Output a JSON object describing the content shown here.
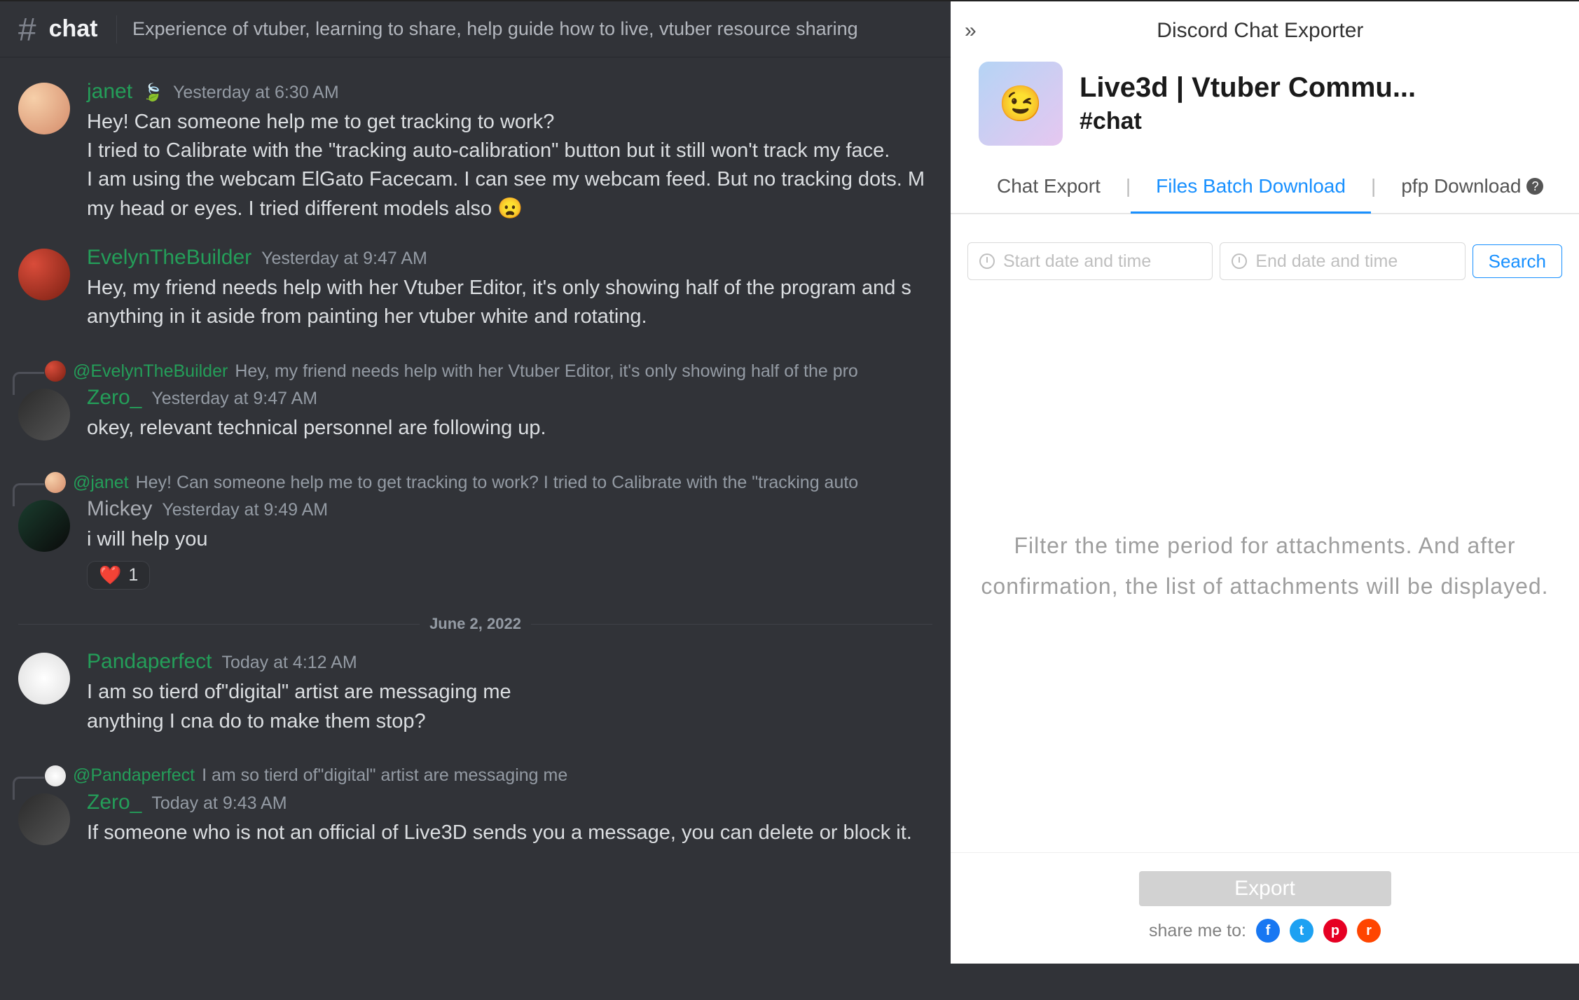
{
  "channel": {
    "name": "chat",
    "topic": "Experience of vtuber, learning to share, help guide how to live, vtuber resource sharing"
  },
  "date_divider": "June 2, 2022",
  "messages": [
    {
      "author": "janet",
      "author_style": "green",
      "leaf": true,
      "timestamp": "Yesterday at 6:30 AM",
      "avatar_class": "av-janet",
      "text": "Hey! Can someone help me to get tracking to work?\nI tried to Calibrate with the \"tracking auto-calibration\" button but it still won't track my face.\nI am using the webcam ElGato Facecam. I can see my webcam feed. But no tracking dots. M\nmy head or eyes. I tried different models also 😦"
    },
    {
      "author": "EvelynTheBuilder",
      "author_style": "green",
      "timestamp": "Yesterday at 9:47 AM",
      "avatar_class": "av-evelyn",
      "text": "Hey, my friend needs help with her Vtuber Editor, it's only showing half of the program and s\nanything in it aside from painting her vtuber white and rotating."
    },
    {
      "reply": {
        "author": "@EvelynTheBuilder",
        "author_style": "green",
        "avatar_class": "av-evelyn",
        "text": "Hey, my friend needs help with her Vtuber Editor, it's only showing half of the pro"
      },
      "author": "Zero_",
      "author_style": "green",
      "timestamp": "Yesterday at 9:47 AM",
      "avatar_class": "av-zero",
      "text": "okey, relevant technical personnel are following up."
    },
    {
      "reply": {
        "author": "@janet",
        "author_style": "green",
        "avatar_class": "av-janet",
        "text": "Hey! Can someone help me to get tracking to work?  I tried to Calibrate with the \"tracking auto"
      },
      "author": "Mickey",
      "author_style": "gray",
      "timestamp": "Yesterday at 9:49 AM",
      "avatar_class": "av-mickey",
      "text": "i will help you",
      "reaction": {
        "emoji": "❤️",
        "count": "1"
      }
    },
    {
      "divider_before": true,
      "author": "Pandaperfect",
      "author_style": "green",
      "timestamp": "Today at 4:12 AM",
      "avatar_class": "av-panda",
      "text": "I am so tierd of\"digital\" artist are messaging me\nanything I cna do to make them stop?"
    },
    {
      "reply": {
        "author": "@Pandaperfect",
        "author_style": "green",
        "avatar_class": "av-panda",
        "text": "I am so tierd of\"digital\" artist are messaging me"
      },
      "author": "Zero_",
      "author_style": "green",
      "timestamp": "Today at 9:43 AM",
      "avatar_class": "av-zero",
      "text": "If someone who is not an official of Live3D sends you a message, you can delete or block it."
    }
  ],
  "panel": {
    "title": "Discord Chat Exporter",
    "server": "Live3d | Vtuber Commu...",
    "channel": "#chat",
    "tabs": {
      "export": "Chat Export",
      "batch": "Files Batch Download",
      "pfp": "pfp Download"
    },
    "start_placeholder": "Start date and time",
    "end_placeholder": "End date and time",
    "search": "Search",
    "hint": "Filter the time period for attachments. And after confirmation, the list of attachments will be displayed.",
    "export_btn": "Export",
    "share_label": "share me to:"
  }
}
